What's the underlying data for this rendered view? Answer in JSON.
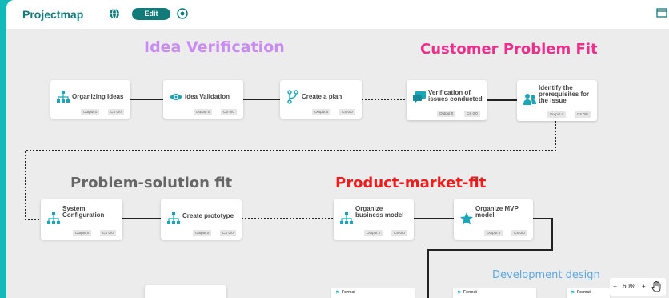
{
  "header": {
    "title": "Projectmap",
    "edit_label": "Edit"
  },
  "phases": [
    {
      "label": "Idea  Verification",
      "color": "#c98cf2"
    },
    {
      "label": "Customer Problem Fit",
      "color": "#ee2e8a"
    },
    {
      "label": "Problem-solution fit",
      "color": "#666666"
    },
    {
      "label": "Product-market-fit",
      "color": "#ee1c1c"
    },
    {
      "label": "Development design",
      "color": "#5aa9e6"
    }
  ],
  "nodes": [
    {
      "label": "Organizing Ideas",
      "icon": "sitemap-icon",
      "tags": [
        "Output 0",
        "CS 0/0"
      ]
    },
    {
      "label": "Idea Validation",
      "icon": "eye-icon",
      "tags": [
        "Output 0",
        "CS 0/0"
      ]
    },
    {
      "label": "Create a plan",
      "icon": "branch-icon",
      "tags": [
        "Output 0",
        "CS 0/0"
      ]
    },
    {
      "label": "Verification of issues conducted",
      "icon": "chat-icon",
      "tags": [
        "Output 0",
        "CS 0/0"
      ]
    },
    {
      "label": "Identify the prerequisites for the issue",
      "icon": "users-icon",
      "tags": [
        "Output 0",
        "CS 0/0"
      ]
    },
    {
      "label": "System Configuration",
      "icon": "sitemap-icon",
      "tags": [
        "Output 0",
        "CS 0/0"
      ]
    },
    {
      "label": "Create prototype",
      "icon": "sitemap-icon",
      "tags": [
        "Output 0",
        "CS 0/0"
      ]
    },
    {
      "label": "Organize business model",
      "icon": "sitemap-icon",
      "tags": [
        "Output 0",
        "CS 0/0"
      ]
    },
    {
      "label": "Organize MVP model",
      "icon": "star-icon",
      "tags": [
        "Output 0",
        "CS 0/0"
      ]
    }
  ],
  "mini_nodes": [
    {
      "label": "Format"
    },
    {
      "label": "Format"
    },
    {
      "label": "Format"
    }
  ],
  "zoom": {
    "minus": "−",
    "level": "60%",
    "plus": "+"
  },
  "colors": {
    "accent": "#127b7b",
    "icon": "#1aa6b7",
    "frame": "#13b8b8"
  }
}
